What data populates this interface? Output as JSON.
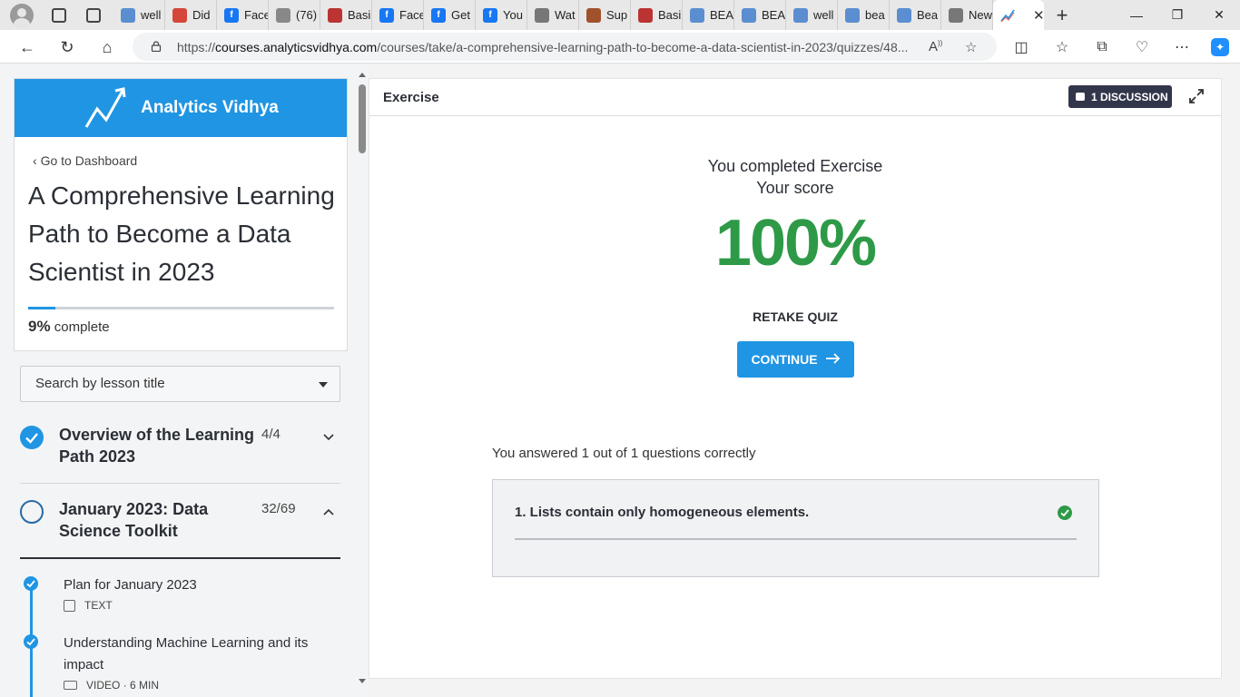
{
  "browser": {
    "tabs": [
      {
        "label": "well",
        "favicon": "search",
        "color": "#5a8ed0"
      },
      {
        "label": "Did",
        "favicon": "gmail",
        "color": "#d44638"
      },
      {
        "label": "Face",
        "favicon": "facebook",
        "color": "#1877f2"
      },
      {
        "label": "(76)",
        "favicon": "doc",
        "color": "#888888"
      },
      {
        "label": "Basi",
        "favicon": "pdf",
        "color": "#b33"
      },
      {
        "label": "Face",
        "favicon": "facebook",
        "color": "#1877f2"
      },
      {
        "label": "Get",
        "favicon": "facebook",
        "color": "#1877f2"
      },
      {
        "label": "You",
        "favicon": "facebook",
        "color": "#1877f2"
      },
      {
        "label": "Wat",
        "favicon": "bag",
        "color": "#777"
      },
      {
        "label": "Sup",
        "favicon": "d",
        "color": "#a0522d"
      },
      {
        "label": "Basi",
        "favicon": "pdf",
        "color": "#b33"
      },
      {
        "label": "BEA",
        "favicon": "search",
        "color": "#5a8ed0"
      },
      {
        "label": "BEA",
        "favicon": "search",
        "color": "#5a8ed0"
      },
      {
        "label": "well",
        "favicon": "search",
        "color": "#5a8ed0"
      },
      {
        "label": "bea",
        "favicon": "search",
        "color": "#5a8ed0"
      },
      {
        "label": "Bea",
        "favicon": "search",
        "color": "#5a8ed0"
      },
      {
        "label": "New",
        "favicon": "calendar",
        "color": "#777"
      }
    ],
    "url_prefix": "https://",
    "url_host": "courses.analyticsvidhya.com",
    "url_path": "/courses/take/a-comprehensive-learning-path-to-become-a-data-scientist-in-2023/quizzes/48..."
  },
  "sidebar": {
    "brand": "Analytics Vidhya",
    "goto_dashboard": "Go to Dashboard",
    "course_title": "A Comprehensive Learning Path to Become a Data Scientist in 2023",
    "progress_percent": 9,
    "progress_value": "9%",
    "progress_suffix": "complete",
    "search_placeholder": "Search by lesson title",
    "chapters": [
      {
        "title": "Overview of the Learning Path 2023",
        "count": "4/4",
        "state": "done"
      },
      {
        "title": "January 2023: Data Science Toolkit",
        "count": "32/69",
        "state": "open"
      }
    ],
    "lessons": [
      {
        "title": "Plan for January 2023",
        "meta": "TEXT"
      },
      {
        "title": "Understanding Machine Learning and its impact",
        "meta": "VIDEO · 6 MIN"
      }
    ]
  },
  "main": {
    "header": "Exercise",
    "discussion_label": "1 DISCUSSION",
    "completed_line1": "You completed Exercise",
    "completed_line2": "Your score",
    "score": "100%",
    "retake": "RETAKE QUIZ",
    "continue": "CONTINUE",
    "answered": "You answered 1 out of 1 questions correctly",
    "question": "1. Lists contain only homogeneous elements."
  },
  "colors": {
    "accent": "#2095e3",
    "success": "#2e9a47",
    "dark_badge": "#32364a"
  }
}
